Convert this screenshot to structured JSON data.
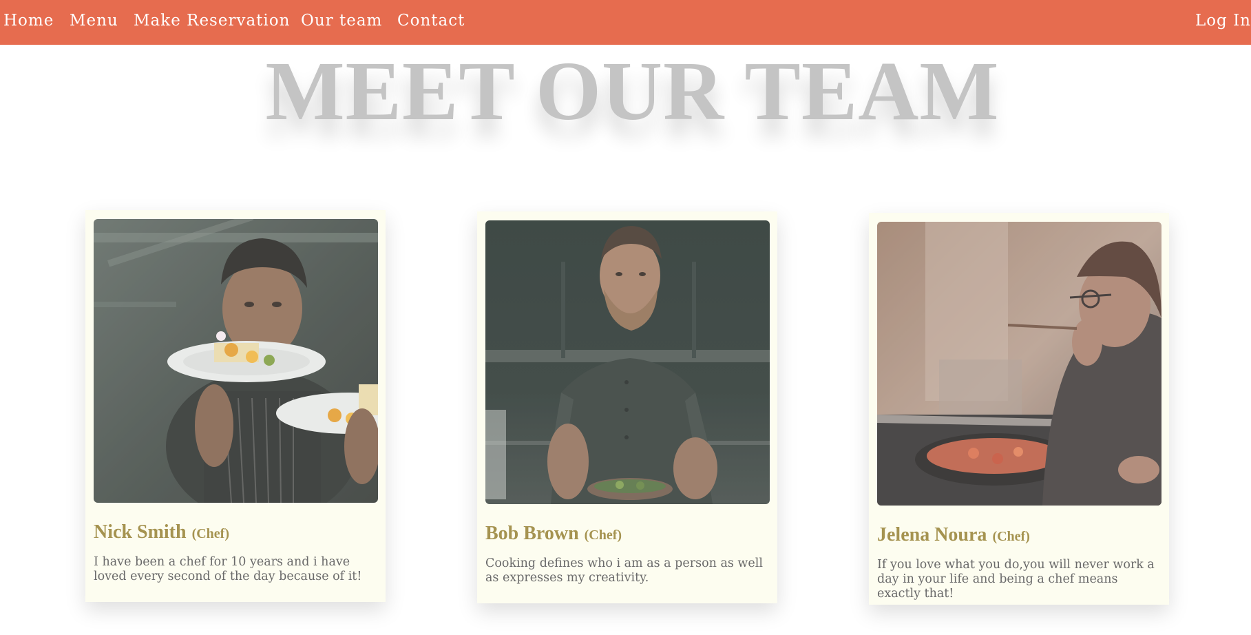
{
  "nav": {
    "links": [
      {
        "label": "Home"
      },
      {
        "label": "Menu"
      },
      {
        "label": "Make Reservation"
      },
      {
        "label": "Our team"
      },
      {
        "label": "Contact"
      }
    ],
    "login_label": "Log In"
  },
  "page": {
    "title": "MEET OUR TEAM"
  },
  "team": [
    {
      "name": "Nick Smith",
      "role": "(Chef)",
      "bio": "I have been a chef for 10 years and i have loved every second of the day because of it!",
      "photo_icon": "chef-holding-plates-photo"
    },
    {
      "name": "Bob Brown",
      "role": "(Chef)",
      "bio": "Cooking defines who i am as a person as well as expresses my creativity.",
      "photo_icon": "chef-holding-bowl-photo"
    },
    {
      "name": "Jelena Noura",
      "role": "(Chef)",
      "bio": "If you love what you do,you will never work a day in your life and being a chef means exactly that!",
      "photo_icon": "chef-tasting-pan-photo"
    }
  ],
  "colors": {
    "nav_background": "#e66c4f",
    "title": "#c4c4c4",
    "card_background": "#fdfdf0",
    "name": "#a59350",
    "bio_text": "#6a6a6a"
  }
}
